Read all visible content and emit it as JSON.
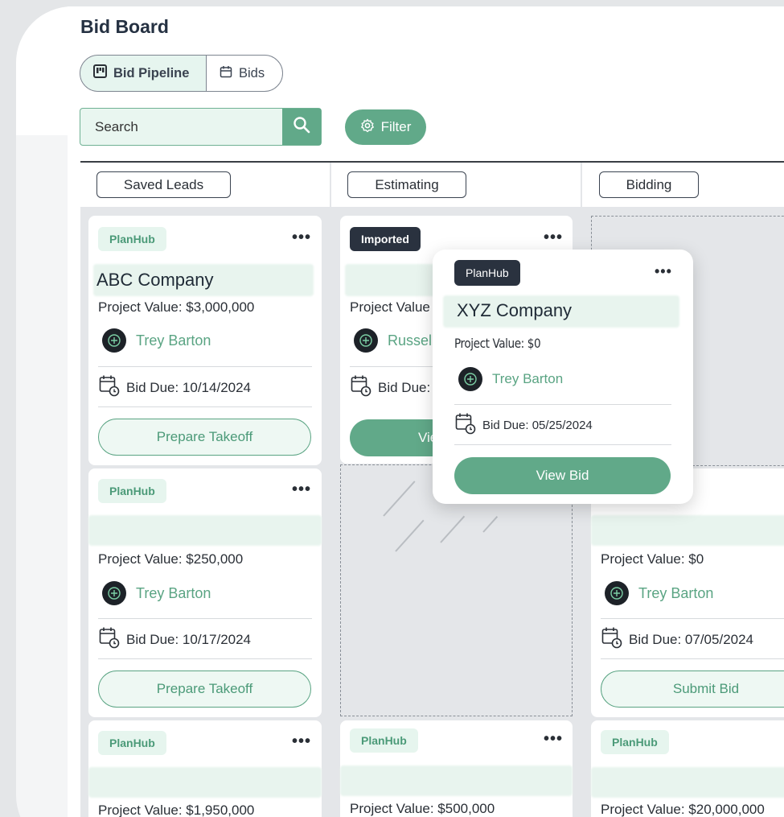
{
  "page": {
    "title": "Bid Board"
  },
  "view_toggle": {
    "pipeline_label": "Bid Pipeline",
    "bids_label": "Bids",
    "active": "Bid Pipeline"
  },
  "search": {
    "placeholder": "Search"
  },
  "filter": {
    "label": "Filter"
  },
  "colors": {
    "accent": "#61a989",
    "accent_light": "#e6f5ee",
    "dark_badge": "#2a323f"
  },
  "columns": [
    {
      "name": "Saved Leads",
      "cards": [
        {
          "source": "PlanHub",
          "company": "ABC Company",
          "project_value": "Project Value: $3,000,000",
          "owner": "Trey Barton",
          "bid_due": "Bid Due: 10/14/2024",
          "action": "Prepare Takeoff"
        },
        {
          "source": "PlanHub",
          "company": "",
          "project_value": "Project Value: $250,000",
          "owner": "Trey Barton",
          "bid_due": "Bid Due: 10/17/2024",
          "action": "Prepare Takeoff"
        },
        {
          "source": "PlanHub",
          "company": "",
          "project_value": "Project Value: $1,950,000"
        }
      ]
    },
    {
      "name": "Estimating",
      "cards": [
        {
          "source": "Imported",
          "project_value": "Project Value",
          "owner": "Russel",
          "bid_due": "Bid Due:",
          "action": "Vie"
        },
        {
          "source": "PlanHub",
          "project_value": "Project Value: $500,000"
        }
      ]
    },
    {
      "name": "Bidding",
      "cards": [
        {
          "project_value": "Project Value: $0",
          "owner": "Trey Barton",
          "bid_due": "Bid Due: 07/05/2024",
          "action": "Submit Bid"
        },
        {
          "source": "PlanHub",
          "project_value": "Project Value: $20,000,000"
        }
      ]
    }
  ],
  "popup_card": {
    "source": "PlanHub",
    "company": "XYZ Company",
    "project_value": "Project Value: $0",
    "owner": "Trey Barton",
    "bid_due": "Bid Due: 05/25/2024",
    "action": "View Bid"
  }
}
